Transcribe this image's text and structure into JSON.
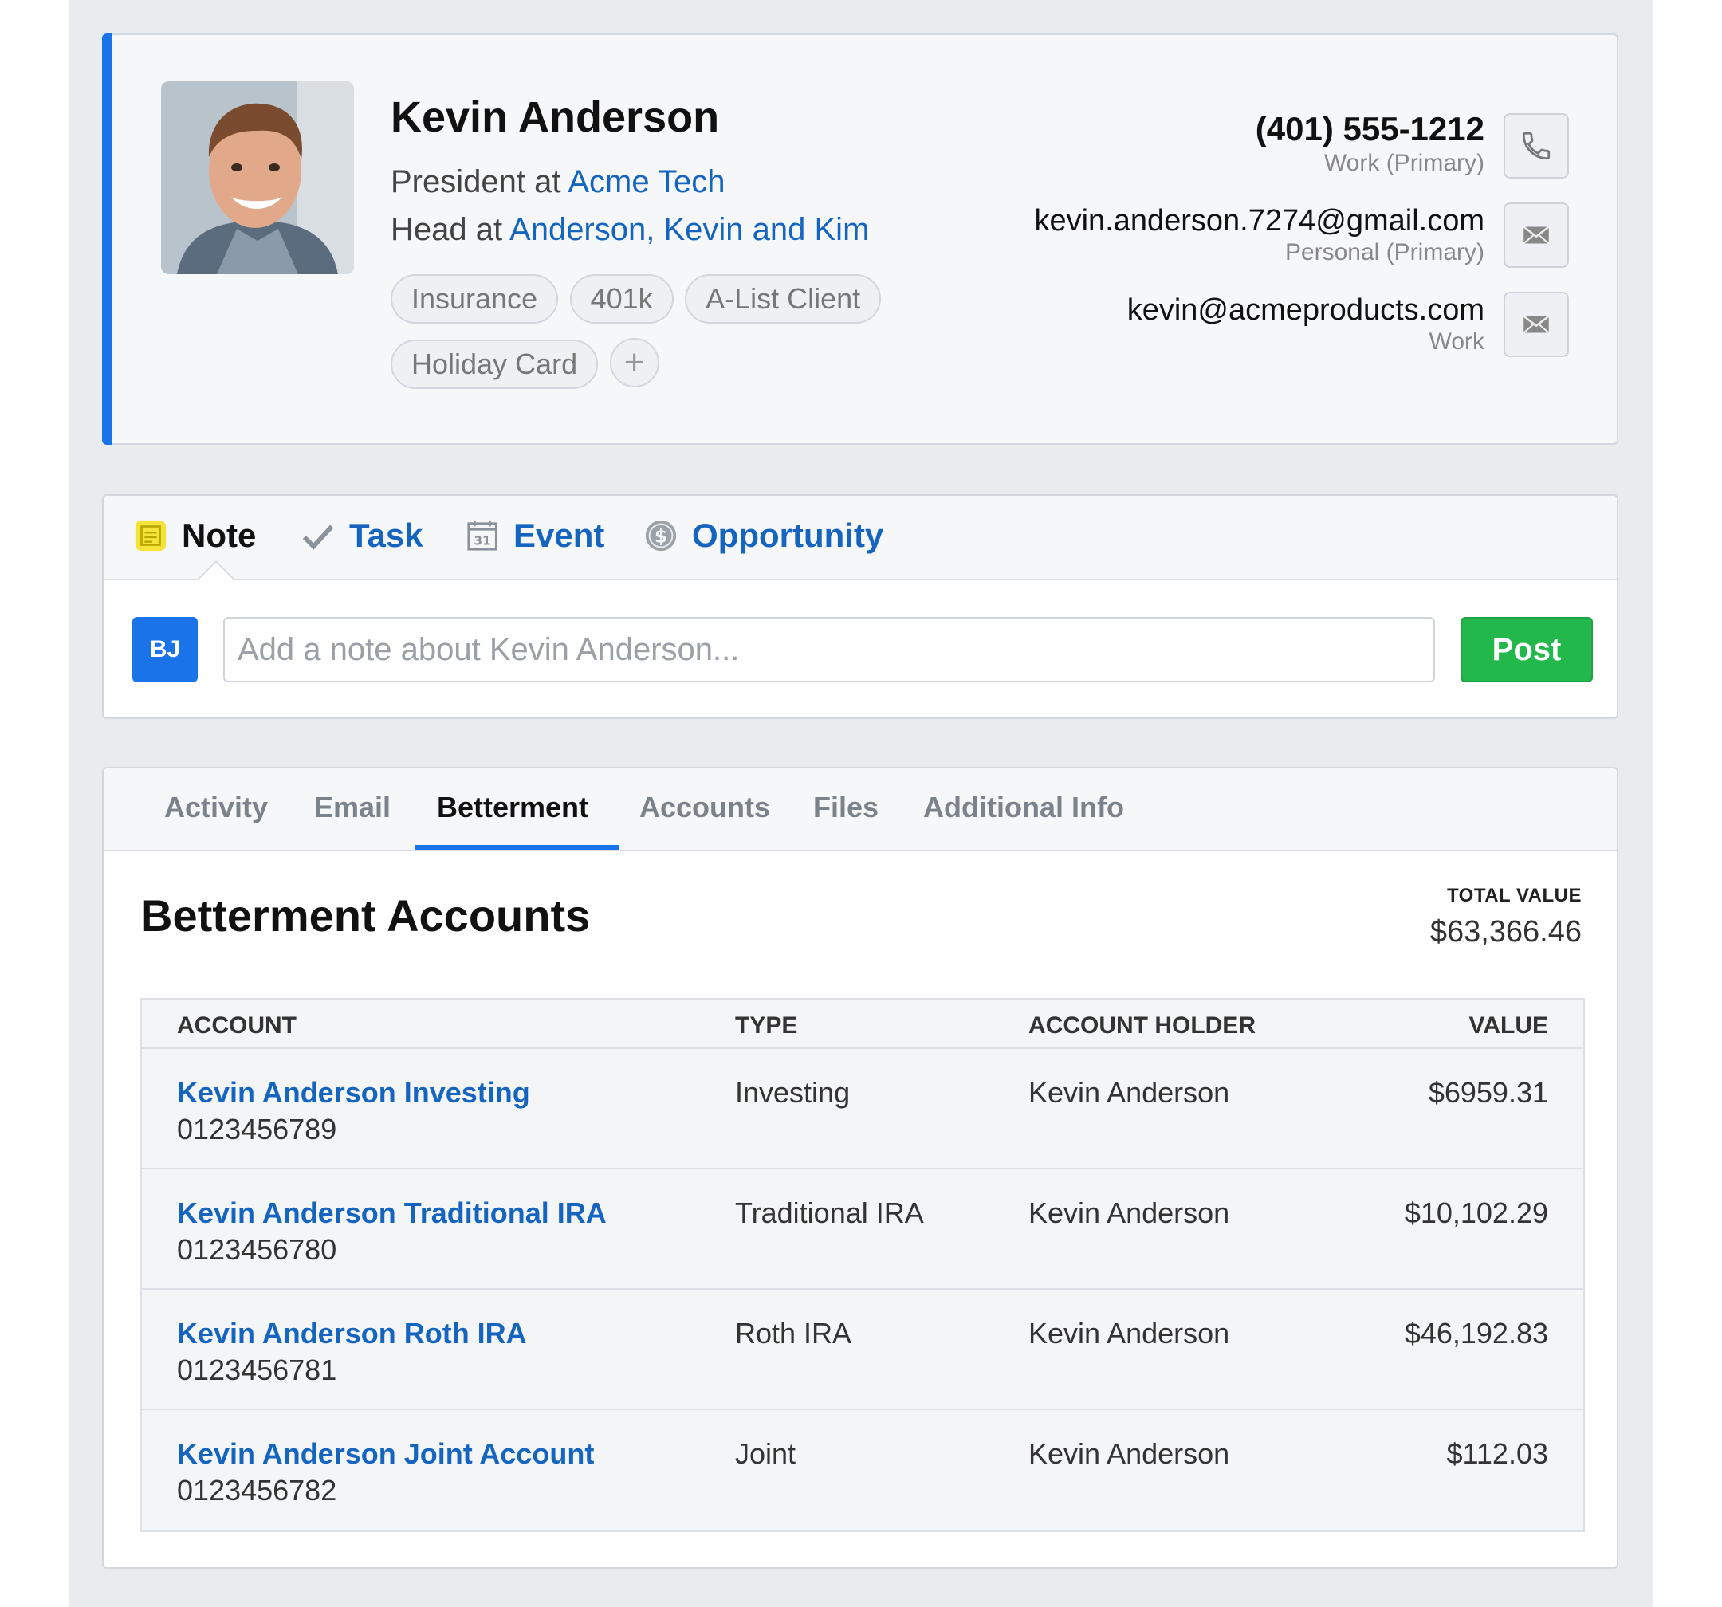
{
  "contact": {
    "name": "Kevin Anderson",
    "role1_prefix": "President at ",
    "role1_link": "Acme Tech",
    "role2_prefix": "Head at ",
    "role2_link": "Anderson, Kevin and Kim",
    "tags": [
      "Insurance",
      "401k",
      "A-List Client",
      "Holiday Card"
    ],
    "add_tag_symbol": "+",
    "phone": {
      "value": "(401) 555-1212",
      "label": "Work (Primary)",
      "icon": "phone-icon"
    },
    "email_personal": {
      "value": "kevin.anderson.7274@gmail.com",
      "label": "Personal (Primary)",
      "icon": "envelope-icon"
    },
    "email_work": {
      "value": "kevin@acmeproducts.com",
      "label": "Work",
      "icon": "envelope-icon"
    }
  },
  "composer": {
    "tabs": [
      {
        "label": "Note",
        "icon": "note-icon",
        "active": true
      },
      {
        "label": "Task",
        "icon": "checkmark-icon"
      },
      {
        "label": "Event",
        "icon": "calendar-icon"
      },
      {
        "label": "Opportunity",
        "icon": "dollar-coin-icon"
      }
    ],
    "user_initials": "BJ",
    "placeholder": "Add a note about Kevin Anderson...",
    "post_label": "Post"
  },
  "panel": {
    "tabs": [
      "Activity",
      "Email",
      "Betterment",
      "Accounts",
      "Files",
      "Additional Info"
    ],
    "active_tab": "Betterment",
    "title": "Betterment Accounts",
    "total_label": "TOTAL VALUE",
    "total_value": "$63,366.46",
    "columns": [
      "ACCOUNT",
      "TYPE",
      "ACCOUNT HOLDER",
      "VALUE"
    ],
    "rows": [
      {
        "name": "Kevin Anderson Investing",
        "number": "0123456789",
        "type": "Investing",
        "holder": "Kevin Anderson",
        "value": "$6959.31"
      },
      {
        "name": "Kevin Anderson Traditional IRA",
        "number": "0123456780",
        "type": "Traditional IRA",
        "holder": "Kevin Anderson",
        "value": "$10,102.29"
      },
      {
        "name": "Kevin Anderson Roth IRA",
        "number": "0123456781",
        "type": "Roth IRA",
        "holder": "Kevin Anderson",
        "value": "$46,192.83"
      },
      {
        "name": "Kevin Anderson Joint Account",
        "number": "0123456782",
        "type": "Joint",
        "holder": "Kevin Anderson",
        "value": "$112.03"
      }
    ]
  },
  "colors": {
    "accent": "#1a73e8",
    "link": "#1565c0",
    "post_button": "#22b84c",
    "note_icon": "#f5e23b"
  }
}
